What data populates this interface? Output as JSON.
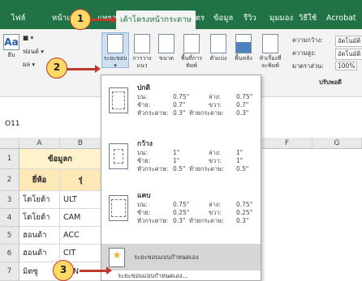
{
  "tabs": [
    "ไฟล์",
    "หน้าแรก",
    "แทรก",
    "เค้าโครงหน้ากระดาษ",
    "สูตร",
    "ข้อมูล",
    "รีวิว",
    "มุมมอง",
    "วิธีใช้",
    "Acrobat"
  ],
  "ribbon": {
    "themes": "ธีม",
    "fonts": "ฟอนต์",
    "effects": "ผล",
    "margins": "ระยะขอบ",
    "orientation": "การวางแนว",
    "size": "ขนาด",
    "print_area": "พื้นที่การพิมพ์",
    "breaks": "ตัวแบ่ง",
    "background": "พื้นหลัง",
    "print_titles": "หัวเรื่องที่จะพิมพ์",
    "width": "ความกว้าง:",
    "height": "ความสูง:",
    "scale": "มาตราส่วน:",
    "width_value": "อัตโนมัติ",
    "height_value": "อัตโนมัติ",
    "scale_value": "100%",
    "scale_group": "ปรับพอดี"
  },
  "name_box": "O11",
  "columns": [
    "A",
    "B",
    "F",
    "G"
  ],
  "rows": [
    "1",
    "2",
    "3",
    "4",
    "5",
    "6",
    "7"
  ],
  "sheet": {
    "title": "ข้อมูลก",
    "header_a": "ยี่ห้อ",
    "header_b": "รุ่",
    "brands": [
      "โตโยต้า",
      "โตโยต้า",
      "ฮอนด้า",
      "ฮอนด้า",
      "มิตซู"
    ],
    "models": [
      "ULT",
      "CAM",
      "ACC",
      "CIT",
      "LAN"
    ]
  },
  "margins_menu": {
    "normal": {
      "name": "ปกติ",
      "top_label": "บน:",
      "top": "0.75\"",
      "bottom_label": "ล่าง:",
      "bottom": "0.75\"",
      "left_label": "ซ้าย:",
      "left": "0.7\"",
      "right_label": "ขวา:",
      "right": "0.7\"",
      "header_label": "หัวกระดาษ:",
      "header": "0.3\"",
      "footer_label": "ท้ายกระดาษ:",
      "footer": "0.3\""
    },
    "wide": {
      "name": "กว้าง",
      "top_label": "บน:",
      "top": "1\"",
      "bottom_label": "ล่าง:",
      "bottom": "1\"",
      "left_label": "ซ้าย:",
      "left": "1\"",
      "right_label": "ขวา:",
      "right": "1\"",
      "header_label": "หัวกระดาษ:",
      "header": "0.5\"",
      "footer_label": "ท้ายกระดาษ:",
      "footer": "0.5\""
    },
    "narrow": {
      "name": "แคบ",
      "top_label": "บน:",
      "top": "0.75\"",
      "bottom_label": "ล่าง:",
      "bottom": "0.75\"",
      "left_label": "ซ้าย:",
      "left": "0.25\"",
      "right_label": "ขวา:",
      "right": "0.25\"",
      "header_label": "หัวกระดาษ:",
      "header": "0.3\"",
      "footer_label": "ท้ายกระดาษ:",
      "footer": "0.3\""
    },
    "custom_name": "ระยะขอบแบบกำหนดเอง",
    "custom_link": "ระยะขอบแบบกำหนดเอง..."
  },
  "badges": [
    "1",
    "2",
    "3"
  ],
  "colors": {
    "ribbon_green": "#217346",
    "badge_fill": "#ffd966",
    "arrow_red": "#c0392b"
  }
}
